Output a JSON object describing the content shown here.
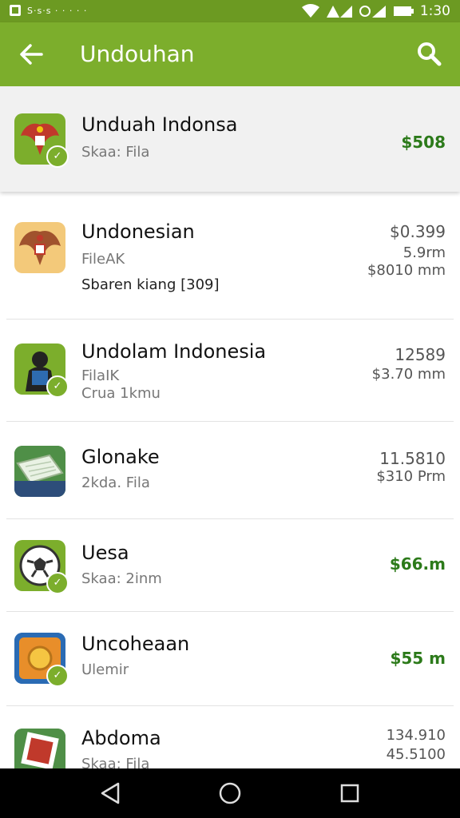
{
  "status_bar": {
    "left_text": "S·s·s · · · · ·",
    "time": "1:30"
  },
  "app_bar": {
    "title": "Undouhan"
  },
  "items": [
    {
      "name": "Unduah Indonsa",
      "sub1": "Skaa: Fila",
      "amount1": "$508",
      "amount_color": "green"
    },
    {
      "name": "Undonesian",
      "sub1": "FileAK",
      "sub2": "Sbaren kiang [309]",
      "amount1": "$0.399",
      "amount2": "5.9rm",
      "amount3": "$8010 mm"
    },
    {
      "name": "Undolam Indonesia",
      "sub1": "FilaIK",
      "sub2": "Crua 1kmu",
      "amount1": "12589",
      "amount2": "$3.70 mm"
    },
    {
      "name": "Glonake",
      "sub1": "2kda. Fila",
      "amount1": "11.5810",
      "amount2": "$310 Prm"
    },
    {
      "name": "Uesa",
      "sub1": "Skaa: 2inm",
      "amount1": "$66.m",
      "amount_color": "green"
    },
    {
      "name": "Uncoheaan",
      "sub1": "Ulemir",
      "amount1": "$55 m",
      "amount_color": "green"
    },
    {
      "name": "Abdoma",
      "sub1": "Skaa: Fila",
      "amount1": "134.910",
      "amount2": "45.5100"
    }
  ],
  "icons": [
    "garuda-icon",
    "garuda-icon",
    "person-icon",
    "map-icon",
    "soccer-ball-icon",
    "coin-icon",
    "photo-icon"
  ]
}
